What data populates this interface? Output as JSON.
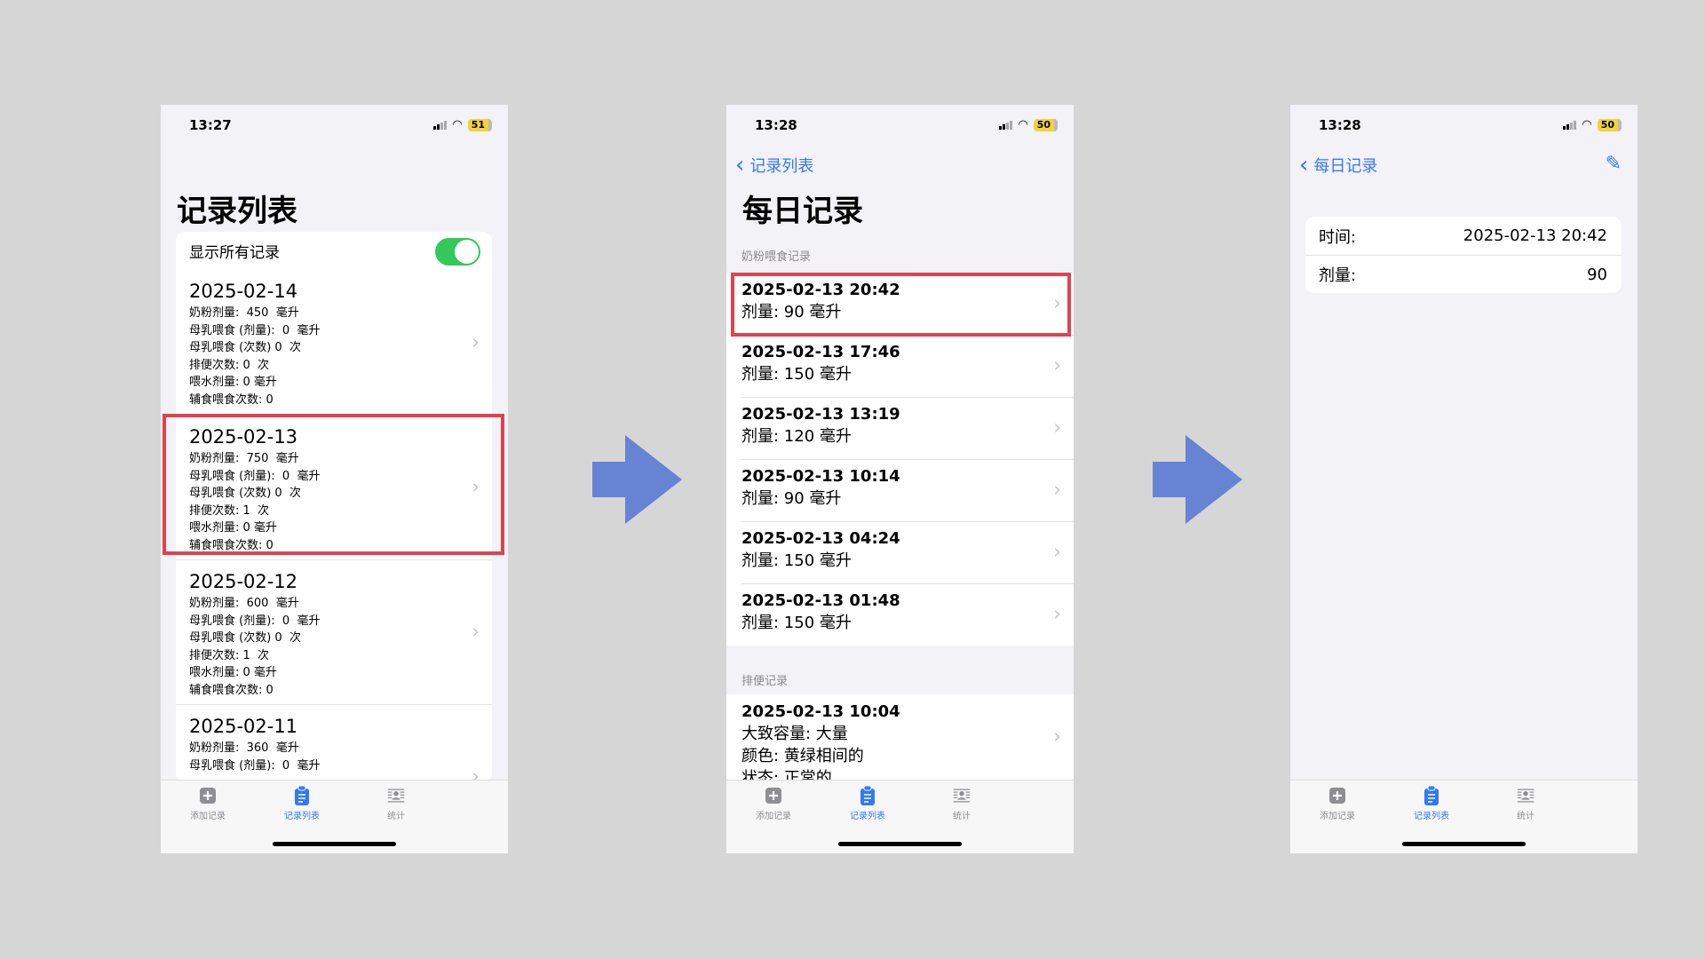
{
  "colors": {
    "accent": "#3478f6",
    "highlight": "#e0424f",
    "arrow": "#6683d4",
    "toggle_on": "#34c759"
  },
  "tabbar": {
    "items": [
      {
        "label": "添加记录",
        "icon": "plus-square-icon"
      },
      {
        "label": "记录列表",
        "icon": "clipboard-icon"
      },
      {
        "label": "统计",
        "icon": "stats-icon"
      }
    ]
  },
  "screen1": {
    "status": {
      "time": "13:27",
      "battery": "51"
    },
    "title": "记录列表",
    "toggle_label": "显示所有记录",
    "toggle_on": true,
    "days": [
      {
        "date": "2025-02-14",
        "lines": [
          "奶粉剂量:  450  毫升",
          "母乳喂食 (剂量):  0  毫升",
          "母乳喂食 (次数) 0  次",
          "排便次数: 0  次",
          "喂水剂量: 0 毫升",
          "辅食喂食次数: 0"
        ]
      },
      {
        "date": "2025-02-13",
        "lines": [
          "奶粉剂量:  750  毫升",
          "母乳喂食 (剂量):  0  毫升",
          "母乳喂食 (次数) 0  次",
          "排便次数: 1  次",
          "喂水剂量: 0 毫升",
          "辅食喂食次数: 0"
        ]
      },
      {
        "date": "2025-02-12",
        "lines": [
          "奶粉剂量:  600  毫升",
          "母乳喂食 (剂量):  0  毫升",
          "母乳喂食 (次数) 0  次",
          "排便次数: 1  次",
          "喂水剂量: 0 毫升",
          "辅食喂食次数: 0"
        ]
      },
      {
        "date": "2025-02-11",
        "lines": [
          "奶粉剂量:  360  毫升",
          "母乳喂食 (剂量):  0  毫升"
        ]
      }
    ]
  },
  "screen2": {
    "status": {
      "time": "13:28",
      "battery": "50"
    },
    "back_label": "记录列表",
    "title": "每日记录",
    "formula_header": "奶粉喂食记录",
    "formula": [
      {
        "time": "2025-02-13 20:42",
        "amount": "剂量: 90 毫升"
      },
      {
        "time": "2025-02-13 17:46",
        "amount": "剂量: 150 毫升"
      },
      {
        "time": "2025-02-13 13:19",
        "amount": "剂量: 120 毫升"
      },
      {
        "time": "2025-02-13 10:14",
        "amount": "剂量: 90 毫升"
      },
      {
        "time": "2025-02-13 04:24",
        "amount": "剂量: 150 毫升"
      },
      {
        "time": "2025-02-13 01:48",
        "amount": "剂量: 150 毫升"
      }
    ],
    "poop_header": "排便记录",
    "poop": [
      {
        "time": "2025-02-13 10:04",
        "lines": [
          "大致容量: 大量",
          "颜色: 黄绿相间的",
          "状态: 正常的"
        ]
      }
    ]
  },
  "screen3": {
    "status": {
      "time": "13:28",
      "battery": "50"
    },
    "back_label": "每日记录",
    "fields": [
      {
        "label": "时间:",
        "value": "2025-02-13 20:42"
      },
      {
        "label": "剂量:",
        "value": "90"
      }
    ]
  }
}
